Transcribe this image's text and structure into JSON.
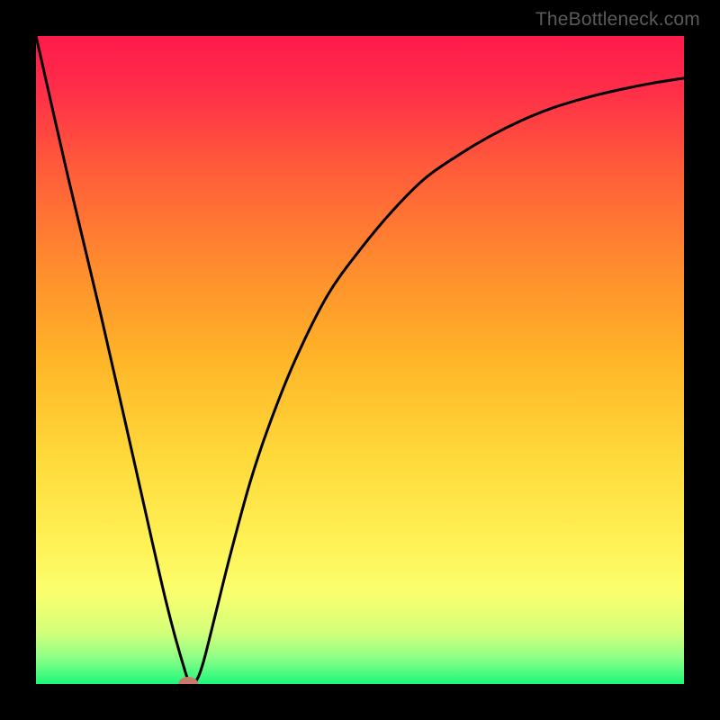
{
  "attribution": "TheBottleneck.com",
  "chart_data": {
    "type": "line",
    "title": "",
    "xlabel": "",
    "ylabel": "",
    "xlim": [
      0,
      100
    ],
    "ylim": [
      0,
      100
    ],
    "grid": false,
    "legend": false,
    "series": [
      {
        "name": "curve",
        "x": [
          0,
          5,
          10,
          15,
          20,
          23,
          24,
          25,
          26,
          28,
          30,
          33,
          36,
          40,
          45,
          50,
          55,
          60,
          65,
          70,
          75,
          80,
          85,
          90,
          95,
          100
        ],
        "y": [
          100,
          78,
          57,
          35,
          13,
          2,
          0,
          1,
          4,
          12,
          20,
          31,
          40,
          50,
          60,
          67,
          73,
          78,
          81.5,
          84.5,
          87,
          89,
          90.5,
          91.7,
          92.7,
          93.5
        ]
      }
    ],
    "markers": [
      {
        "name": "selected-point",
        "x": 23.5,
        "y": 0,
        "color": "#c97a6a"
      }
    ],
    "background_gradient": {
      "type": "vertical",
      "stops": [
        {
          "pos": 0.0,
          "color": "#ff1a4b"
        },
        {
          "pos": 0.08,
          "color": "#ff2d49"
        },
        {
          "pos": 0.2,
          "color": "#ff5a3a"
        },
        {
          "pos": 0.35,
          "color": "#ff8a2e"
        },
        {
          "pos": 0.5,
          "color": "#ffb528"
        },
        {
          "pos": 0.65,
          "color": "#ffd93a"
        },
        {
          "pos": 0.78,
          "color": "#fff155"
        },
        {
          "pos": 0.86,
          "color": "#faff6e"
        },
        {
          "pos": 0.92,
          "color": "#d4ff7a"
        },
        {
          "pos": 0.96,
          "color": "#8cff86"
        },
        {
          "pos": 1.0,
          "color": "#1df77b"
        }
      ]
    }
  }
}
